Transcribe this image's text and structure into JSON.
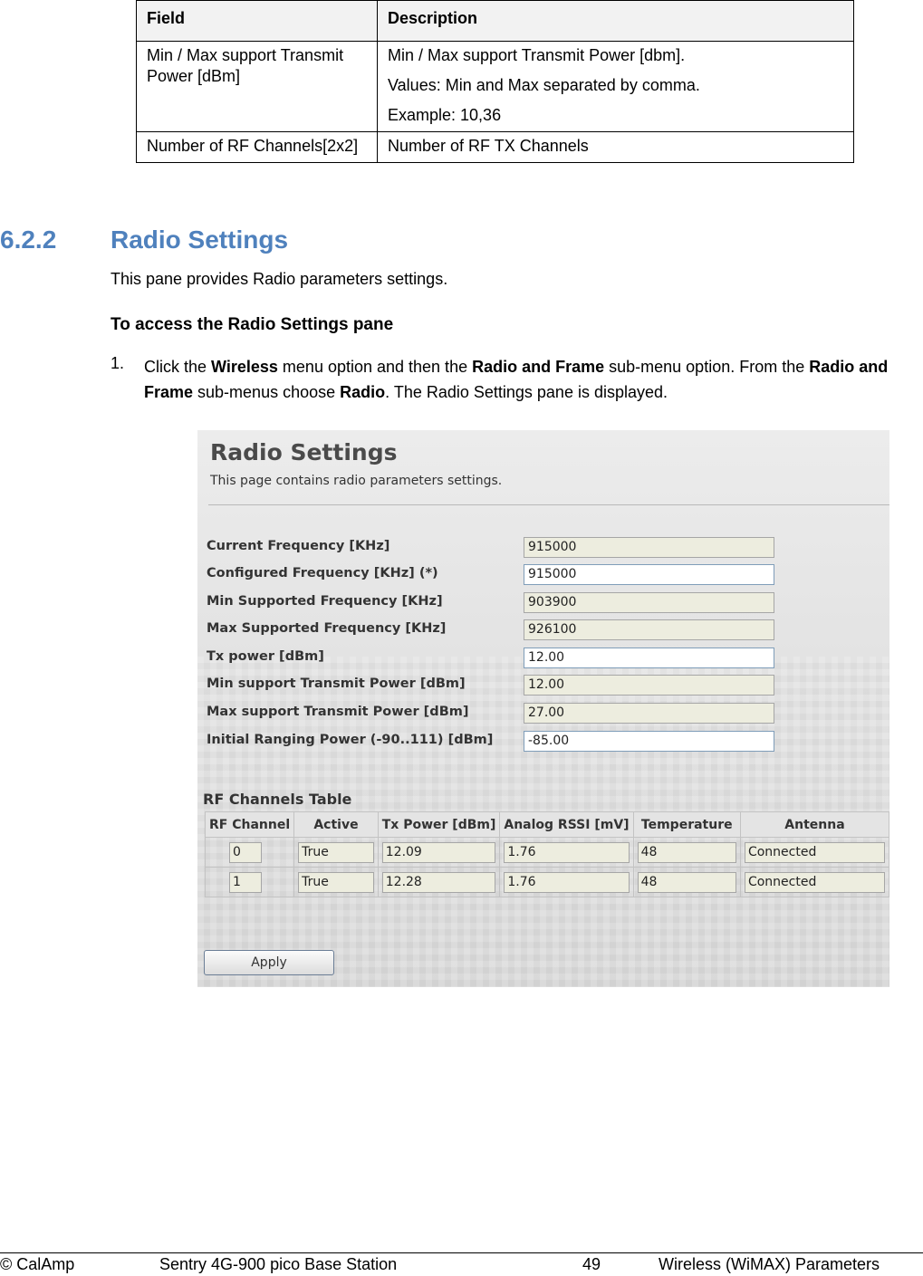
{
  "field_table": {
    "headers": [
      "Field",
      "Description"
    ],
    "rows": [
      {
        "field": "Min / Max support Transmit Power [dBm]",
        "desc": [
          "Min / Max support Transmit Power  [dbm].",
          "Values: Min and Max separated by comma.",
          "Example: 10,36"
        ]
      },
      {
        "field": "Number of RF Channels[2x2]",
        "desc": [
          "Number of RF TX Channels"
        ]
      }
    ]
  },
  "section": {
    "number": "6.2.2",
    "title": "Radio Settings",
    "intro": "This pane provides Radio parameters settings.",
    "subheading": "To access the Radio Settings pane",
    "step_number": "1.",
    "step": {
      "t1": "Click the ",
      "b1": "Wireless",
      "t2": "  menu option and then the ",
      "b2": "Radio and Frame",
      "t3": " sub-menu option. From the ",
      "b3": "Radio and Frame",
      "t4": " sub-menus choose ",
      "b4": "Radio",
      "t5": ". The Radio Settings pane is displayed."
    }
  },
  "screenshot": {
    "title": "Radio Settings",
    "subtitle": "This page contains radio parameters settings.",
    "fields": [
      {
        "label": "Current Frequency [KHz]",
        "value": "915000"
      },
      {
        "label": "Configured Frequency [KHz] (*)",
        "value": "915000"
      },
      {
        "label": "Min Supported Frequency [KHz]",
        "value": "903900"
      },
      {
        "label": "Max Supported Frequency [KHz]",
        "value": "926100"
      },
      {
        "label": "Tx power [dBm]",
        "value": "12.00"
      },
      {
        "label": "Min support Transmit Power [dBm]",
        "value": "12.00"
      },
      {
        "label": "Max support Transmit Power [dBm]",
        "value": "27.00"
      },
      {
        "label": "Initial Ranging Power (-90..111) [dBm]",
        "value": "-85.00"
      }
    ],
    "rf_table": {
      "title": "RF Channels Table",
      "headers": [
        "RF Channel",
        "Active",
        "Tx Power [dBm]",
        "Analog RSSI [mV]",
        "Temperature",
        "Antenna"
      ],
      "rows": [
        [
          "0",
          "True",
          "12.09",
          "1.76",
          "48",
          "Connected"
        ],
        [
          "1",
          "True",
          "12.28",
          "1.76",
          "48",
          "Connected"
        ]
      ]
    },
    "apply_label": "Apply"
  },
  "footer": {
    "company": "© CalAmp",
    "product": "Sentry 4G-900 pico Base Station",
    "page": "49",
    "chapter": "Wireless (WiMAX) Parameters"
  }
}
